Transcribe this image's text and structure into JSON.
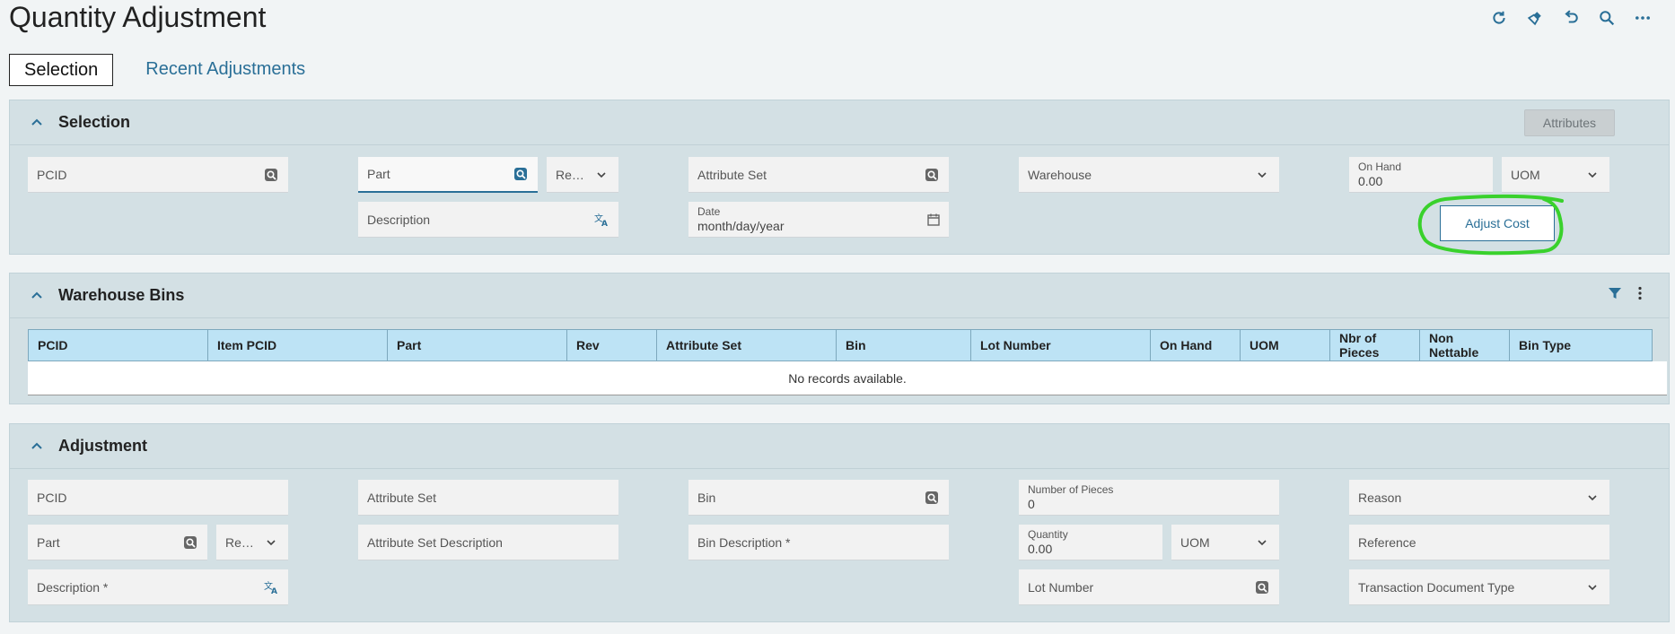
{
  "page": {
    "title": "Quantity Adjustment",
    "toolbar": [
      "refresh-icon",
      "clear-icon",
      "undo-icon",
      "search-icon",
      "more-icon"
    ]
  },
  "tabs": [
    {
      "label": "Selection",
      "active": true
    },
    {
      "label": "Recent Adjustments",
      "active": false
    }
  ],
  "selection": {
    "title": "Selection",
    "attributes_button": "Attributes",
    "pcid": "PCID",
    "part": "Part",
    "revision": "Revi...",
    "description": "Description",
    "attribute_set": "Attribute Set",
    "date_label": "Date",
    "date_value": "month/day/year",
    "warehouse": "Warehouse",
    "on_hand_label": "On Hand",
    "on_hand_value": "0.00",
    "uom": "UOM",
    "adjust_cost_button": "Adjust Cost"
  },
  "warehouse_bins": {
    "title": "Warehouse Bins",
    "columns": [
      "PCID",
      "Item PCID",
      "Part",
      "Rev",
      "Attribute Set",
      "Bin",
      "Lot Number",
      "On Hand",
      "UOM",
      "Nbr of Pieces",
      "Non Nettable",
      "Bin Type"
    ],
    "empty_message": "No records available."
  },
  "adjustment": {
    "title": "Adjustment",
    "pcid": "PCID",
    "part": "Part",
    "revision": "Revi...",
    "description": "Description *",
    "attribute_set": "Attribute Set",
    "attribute_set_description": "Attribute Set Description",
    "bin": "Bin",
    "bin_description": "Bin Description *",
    "number_of_pieces_label": "Number of Pieces",
    "number_of_pieces_value": "0",
    "quantity_label": "Quantity",
    "quantity_value": "0.00",
    "uom": "UOM",
    "lot_number": "Lot Number",
    "reason": "Reason",
    "reference": "Reference",
    "transaction_document_type": "Transaction Document Type"
  },
  "colors": {
    "accent": "#2a6f97",
    "panel_bg": "#d3e0e4",
    "grid_header": "#bde3f5",
    "annotation": "#39d12c"
  }
}
